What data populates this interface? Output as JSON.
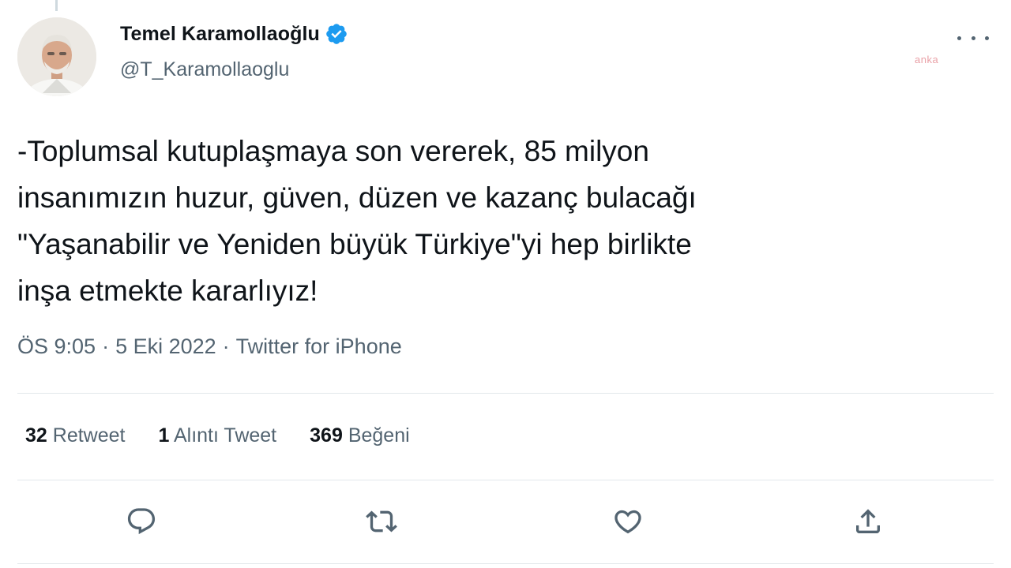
{
  "author": {
    "name": "Temel Karamollaoğlu",
    "handle": "@T_Karamollaoglu",
    "verified": true
  },
  "watermark": "anka",
  "tweet": {
    "text": "-Toplumsal kutuplaşmaya son vererek, 85 milyon\ninsanımızın huzur, güven, düzen ve kazanç bulacağı\n\"Yaşanabilir ve Yeniden büyük Türkiye\"yi hep birlikte\ninşa etmekte kararlıyız!",
    "time": "ÖS 9:05",
    "date": "5 Eki 2022",
    "separator": "·",
    "source": "Twitter for iPhone"
  },
  "stats": {
    "retweets": {
      "count": "32",
      "label": "Retweet"
    },
    "quotes": {
      "count": "1",
      "label": "Alıntı Tweet"
    },
    "likes": {
      "count": "369",
      "label": "Beğeni"
    }
  },
  "icons": {
    "more": "more-dots-icon",
    "verified": "verified-badge-icon",
    "reply": "reply-bubble-icon",
    "retweet": "retweet-arrows-icon",
    "like": "heart-icon",
    "share": "share-upload-icon"
  },
  "colors": {
    "text": "#0f1419",
    "secondary": "#536471",
    "verified": "#1d9bf0",
    "divider": "#e3e8eb"
  }
}
